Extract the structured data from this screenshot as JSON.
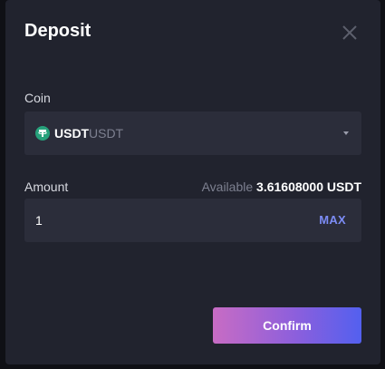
{
  "modal": {
    "title": "Deposit"
  },
  "coin": {
    "label": "Coin",
    "symbol": "USDT",
    "name": "USDT",
    "icon": "tether-icon"
  },
  "amount": {
    "label": "Amount",
    "available_label": "Available",
    "available_value": "3.61608000 USDT",
    "value": "1",
    "max_label": "MAX"
  },
  "actions": {
    "confirm_label": "Confirm"
  },
  "colors": {
    "background": "#21232e",
    "field": "#2b2d3a",
    "accent": "#7c8cf5",
    "tether": "#26a17b"
  }
}
